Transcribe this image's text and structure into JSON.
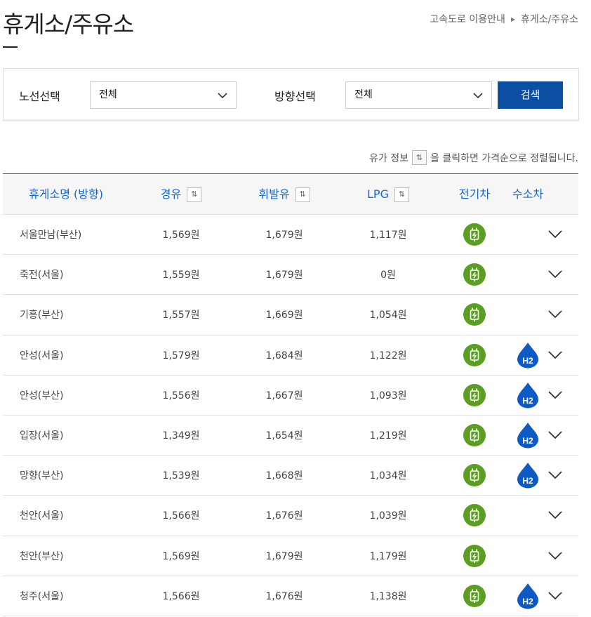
{
  "page": {
    "title": "휴게소/주유소",
    "breadcrumb": [
      "고속도로 이용안내",
      "휴게소/주유소"
    ]
  },
  "filters": {
    "route_label": "노선선택",
    "route_value": "전체",
    "direction_label": "방향선택",
    "direction_value": "전체",
    "search_label": "검색"
  },
  "sort_note": {
    "before": "유가 정보",
    "after": "을 클릭하면 가격순으로 정렬됩니다."
  },
  "table": {
    "headers": {
      "name": "휴게소명 (방향)",
      "diesel": "경유",
      "gasoline": "휘발유",
      "lpg": "LPG",
      "ev": "전기차",
      "h2": "수소차"
    },
    "rows": [
      {
        "name": "서울만남(부산)",
        "diesel": "1,569원",
        "gasoline": "1,679원",
        "lpg": "1,117원",
        "ev": true,
        "h2": false
      },
      {
        "name": "죽전(서울)",
        "diesel": "1,559원",
        "gasoline": "1,679원",
        "lpg": "0원",
        "ev": true,
        "h2": false
      },
      {
        "name": "기흥(부산)",
        "diesel": "1,557원",
        "gasoline": "1,669원",
        "lpg": "1,054원",
        "ev": true,
        "h2": false
      },
      {
        "name": "안성(서울)",
        "diesel": "1,579원",
        "gasoline": "1,684원",
        "lpg": "1,122원",
        "ev": true,
        "h2": true
      },
      {
        "name": "안성(부산)",
        "diesel": "1,556원",
        "gasoline": "1,667원",
        "lpg": "1,093원",
        "ev": true,
        "h2": true
      },
      {
        "name": "입장(서울)",
        "diesel": "1,349원",
        "gasoline": "1,654원",
        "lpg": "1,219원",
        "ev": true,
        "h2": true
      },
      {
        "name": "망향(부산)",
        "diesel": "1,539원",
        "gasoline": "1,668원",
        "lpg": "1,034원",
        "ev": true,
        "h2": true
      },
      {
        "name": "천안(서울)",
        "diesel": "1,566원",
        "gasoline": "1,676원",
        "lpg": "1,039원",
        "ev": true,
        "h2": false
      },
      {
        "name": "천안(부산)",
        "diesel": "1,569원",
        "gasoline": "1,679원",
        "lpg": "1,179원",
        "ev": true,
        "h2": false
      },
      {
        "name": "청주(서울)",
        "diesel": "1,566원",
        "gasoline": "1,676원",
        "lpg": "1,138원",
        "ev": true,
        "h2": true
      }
    ]
  },
  "icons": {
    "ev": "ev-charger-icon",
    "h2": "hydrogen-drop-icon",
    "expand": "chevron-down-icon",
    "sort": "sort-updown-icon",
    "breadcrumb_sep": "triangle-right-icon"
  },
  "h2_text": "H2",
  "colors": {
    "accent": "#0b4ea2",
    "header_text": "#1566d6",
    "ev_green": "#5c9e22",
    "h2_blue": "#0d5ac4"
  }
}
